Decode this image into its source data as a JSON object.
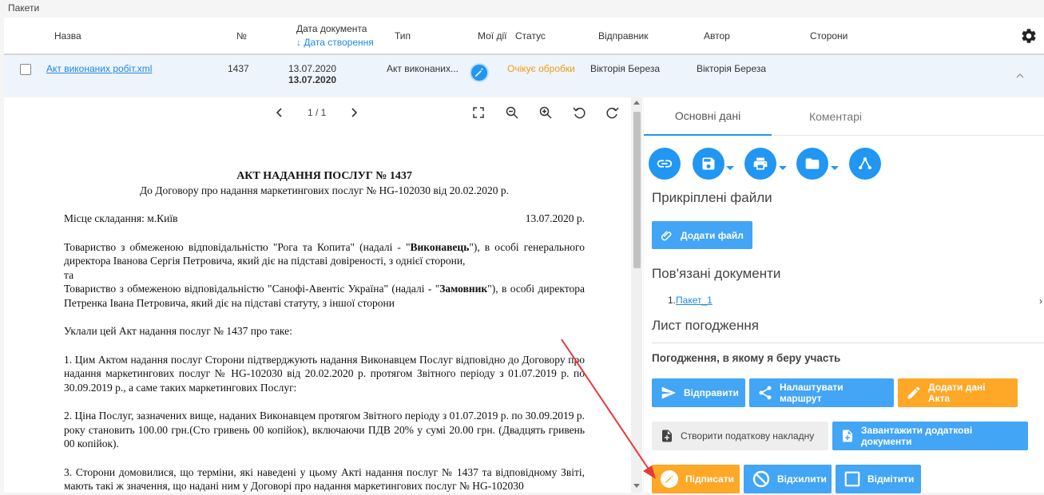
{
  "breadcrumb": "Пакети",
  "table": {
    "headers": {
      "name": "Назва",
      "number": "№",
      "doc_date": "Дата документа",
      "created_date": "↓ Дата створення",
      "type": "Тип",
      "my_actions": "Мої дії",
      "status": "Статус",
      "sender": "Відправник",
      "author": "Автор",
      "parties": "Сторони"
    },
    "row": {
      "name": "Акт виконаних робіт.xml",
      "number": "1437",
      "doc_date": "13.07.2020",
      "created_date": "13.07.2020",
      "type": "Акт виконаних...",
      "status": "Очікує обробки",
      "sender": "Вікторія Береза",
      "author": "Вікторія Береза"
    }
  },
  "viewer": {
    "page_indicator": "1 / 1",
    "document": {
      "title": "АКТ НАДАННЯ ПОСЛУГ № 1437",
      "subtitle": "До Договору про надання маркетингових послуг № HG-102030 від 20.02.2020 р.",
      "place": "Місце складання: м.Київ",
      "date": "13.07.2020 р.",
      "p1_a": "Товариство з обмеженою відповідальністю \"Рога та Копита\" (надалі - \"",
      "p1_b": "Виконавець",
      "p1_c": "\"), в особі генерального директора Іванова Сергія Петровича, який діє на підставі довіреності, з однієї сторони,",
      "p1_and": "та",
      "p2_a": "Товариство з обмеженою відповідальністю \"Санофі-Авентіс Україна\" (надалі - \"",
      "p2_b": "Замовник",
      "p2_c": "\"), в особі директора Петренка Івана Петровича, який діє на підставі статуту, з іншої сторони",
      "p3": "Уклали цей Акт надання послуг № 1437 про таке:",
      "p4": "1. Цим Актом надання послуг Сторони підтверджують надання Виконавцем Послуг відповідно до Договору про надання маркетингових послуг № HG-102030 від 20.02.2020 р. протягом Звітного періоду з 01.07.2019 р. по 30.09.2019 р., а саме таких маркетингових Послуг:",
      "p5": "2. Ціна Послуг, зазначених вище, наданих Виконавцем протягом Звітного періоду з 01.07.2019 р. по 30.09.2019 р. року становить 100.00 грн.(Сто гривень 00 копійок), включаючи ПДВ 20% у сумі 20.00 грн. (Двадцять гривень 00 копійок).",
      "p6": "3. Сторони домовилися, що терміни, які наведені у цьому Акті надання послуг № 1437 та відповідному Звіті, мають такі ж значення, що надані ним у Договорі про надання маркетингових послуг № HG-102030"
    }
  },
  "side": {
    "tabs": [
      "Основні дані",
      "Коментарі"
    ],
    "attached_title": "Прикріплені файли",
    "add_file": "Додати файл",
    "related_title": "Пов'язані документи",
    "related_index": "1.",
    "related_link": "Пакет_1",
    "related_arrow": "›",
    "approval_title": "Лист погодження",
    "approval_sub": "Погодження, в якому я беру участь",
    "buttons": {
      "send": "Відправити",
      "route": "Налаштувати маршрут",
      "act_data": "Додати дані Акта",
      "tax_invoice": "Створити податкову накладну",
      "upload_docs": "Завантажити додаткові документи",
      "sign": "Підписати",
      "reject": "Відхилити",
      "mark": "Відмітити"
    }
  },
  "colors": {
    "primary": "#2196f3",
    "button_blue": "#42a5f5",
    "button_orange": "#ffa726",
    "status_orange": "#f59a0c",
    "annotation_red": "#e53935"
  }
}
